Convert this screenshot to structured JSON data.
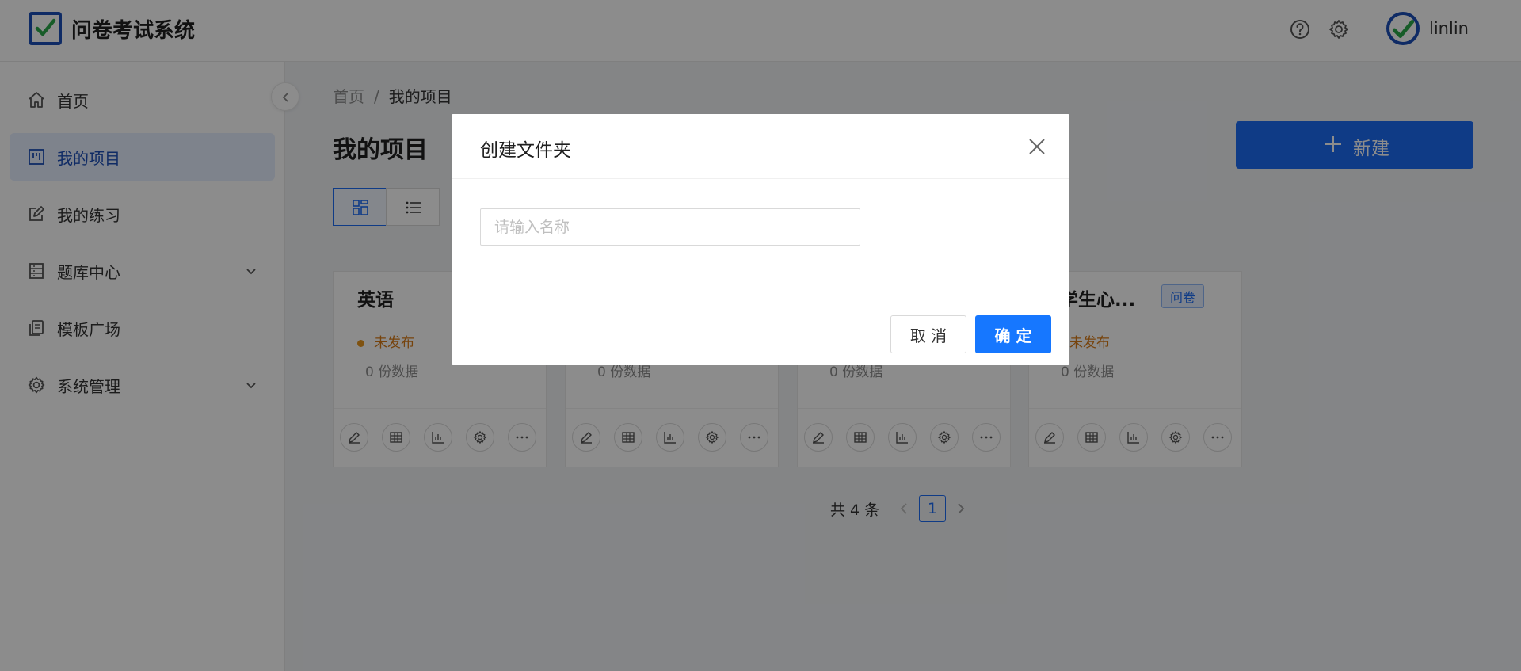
{
  "header": {
    "app_title": "问卷考试系统",
    "username": "linlin",
    "icons": [
      "help-icon",
      "gear-icon"
    ]
  },
  "sidebar": {
    "items": [
      {
        "label": "首页",
        "icon": "home-icon"
      },
      {
        "label": "我的项目",
        "icon": "project-icon",
        "active": true
      },
      {
        "label": "我的练习",
        "icon": "edit-icon"
      },
      {
        "label": "题库中心",
        "icon": "database-icon",
        "expandable": true
      },
      {
        "label": "模板广场",
        "icon": "template-icon"
      },
      {
        "label": "系统管理",
        "icon": "gear-icon",
        "expandable": true
      }
    ]
  },
  "main": {
    "breadcrumb": {
      "home": "首页",
      "separator": "/",
      "current": "我的项目"
    },
    "title": "我的项目",
    "new_button": "新建",
    "cards": [
      {
        "title": "英语",
        "tag": "",
        "status": "未发布",
        "count": "0  份数据"
      },
      {
        "title": "",
        "tag": "",
        "status": "",
        "count": "0  份数据"
      },
      {
        "title": "",
        "tag": "",
        "status": "",
        "count": "0  份数据"
      },
      {
        "title": "大学生心...",
        "tag": "问卷",
        "status": "未发布",
        "count": "0  份数据"
      }
    ],
    "pagination": {
      "total": "共 4 条",
      "current": "1"
    }
  },
  "modal": {
    "title": "创建文件夹",
    "input_placeholder": "请输入名称",
    "input_value": "",
    "cancel": "取 消",
    "ok": "确 定"
  },
  "colors": {
    "primary": "#1677ff",
    "brand": "#1d4fb8",
    "warning": "#d87a16"
  }
}
